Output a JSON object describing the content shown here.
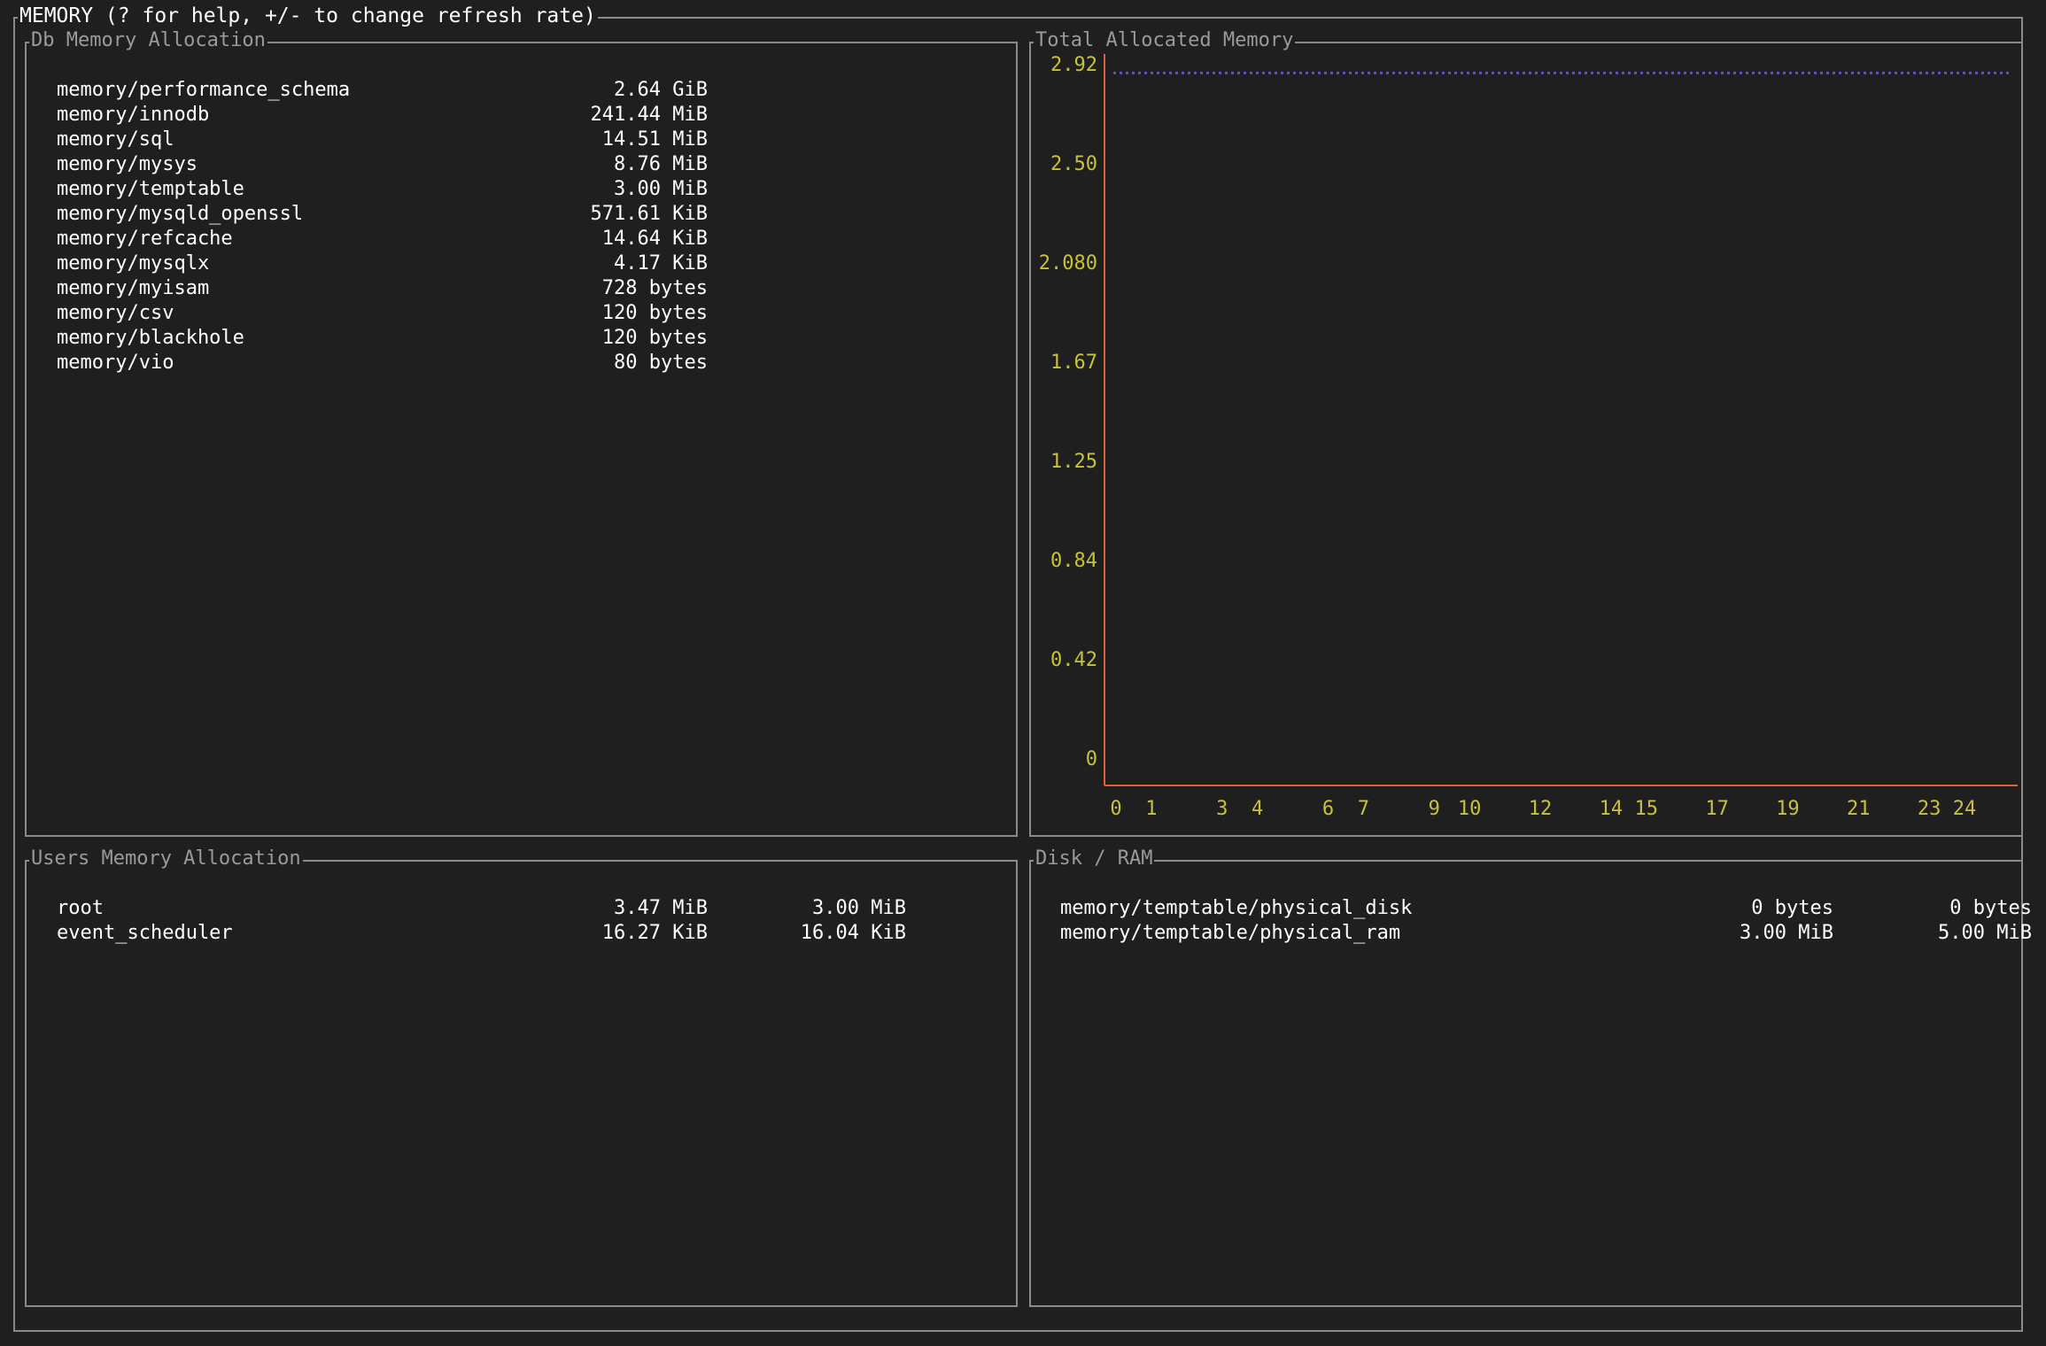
{
  "window": {
    "title": "MEMORY (? for help, +/- to change refresh rate)"
  },
  "db_memory": {
    "title": "Db Memory Allocation",
    "rows": [
      {
        "name": "memory/performance_schema",
        "value": "2.64 GiB"
      },
      {
        "name": "memory/innodb",
        "value": "241.44 MiB"
      },
      {
        "name": "memory/sql",
        "value": "14.51 MiB"
      },
      {
        "name": "memory/mysys",
        "value": "8.76 MiB"
      },
      {
        "name": "memory/temptable",
        "value": "3.00 MiB"
      },
      {
        "name": "memory/mysqld_openssl",
        "value": "571.61 KiB"
      },
      {
        "name": "memory/refcache",
        "value": "14.64 KiB"
      },
      {
        "name": "memory/mysqlx",
        "value": "4.17 KiB"
      },
      {
        "name": "memory/myisam",
        "value": "728 bytes"
      },
      {
        "name": "memory/csv",
        "value": "120 bytes"
      },
      {
        "name": "memory/blackhole",
        "value": "120 bytes"
      },
      {
        "name": "memory/vio",
        "value": "80 bytes"
      }
    ]
  },
  "users_memory": {
    "title": "Users Memory Allocation",
    "rows": [
      {
        "name": "root",
        "value1": "3.47 MiB",
        "value2": "3.00 MiB"
      },
      {
        "name": "event_scheduler",
        "value1": "16.27 KiB",
        "value2": "16.04 KiB"
      }
    ]
  },
  "disk_ram": {
    "title": "Disk / RAM",
    "rows": [
      {
        "name": "memory/temptable/physical_disk",
        "value1": "0 bytes",
        "value2": "0 bytes"
      },
      {
        "name": "memory/temptable/physical_ram",
        "value1": "3.00 MiB",
        "value2": "5.00 MiB"
      }
    ]
  },
  "colors": {
    "background": "#1f1f1f",
    "border": "#8a8a8a",
    "panel_title": "#9a9a9a",
    "text": "#ffffff",
    "tick": "#c8c23a",
    "axis": "#e0603c",
    "series": "#5a4fe0"
  },
  "chart_data": {
    "type": "line",
    "title": "Total Allocated Memory",
    "xlabel": "",
    "ylabel": "",
    "y_ticks": [
      "2.92",
      "2.50",
      "2.080",
      "1.67",
      "1.25",
      "0.84",
      "0.42",
      "0"
    ],
    "x_ticks": [
      "0",
      "1",
      "3",
      "4",
      "6",
      "7",
      "9",
      "10",
      "12",
      "14",
      "15",
      "17",
      "19",
      "21",
      "23",
      "24"
    ],
    "ylim": [
      0,
      2.92
    ],
    "xlim": [
      0,
      25
    ],
    "series": [
      {
        "x": [
          0,
          1,
          2,
          3,
          4,
          5,
          6,
          7,
          8,
          9,
          10,
          11,
          12,
          13,
          14,
          15,
          16,
          17,
          18,
          19,
          20,
          21,
          22,
          23,
          24,
          25
        ],
        "y": [
          2.9,
          2.9,
          2.9,
          2.9,
          2.9,
          2.9,
          2.9,
          2.9,
          2.9,
          2.9,
          2.9,
          2.9,
          2.9,
          2.9,
          2.9,
          2.9,
          2.9,
          2.9,
          2.9,
          2.9,
          2.9,
          2.9,
          2.9,
          2.9,
          2.9,
          2.9
        ],
        "style": "dotted"
      }
    ],
    "grid": false,
    "legend": "none"
  }
}
